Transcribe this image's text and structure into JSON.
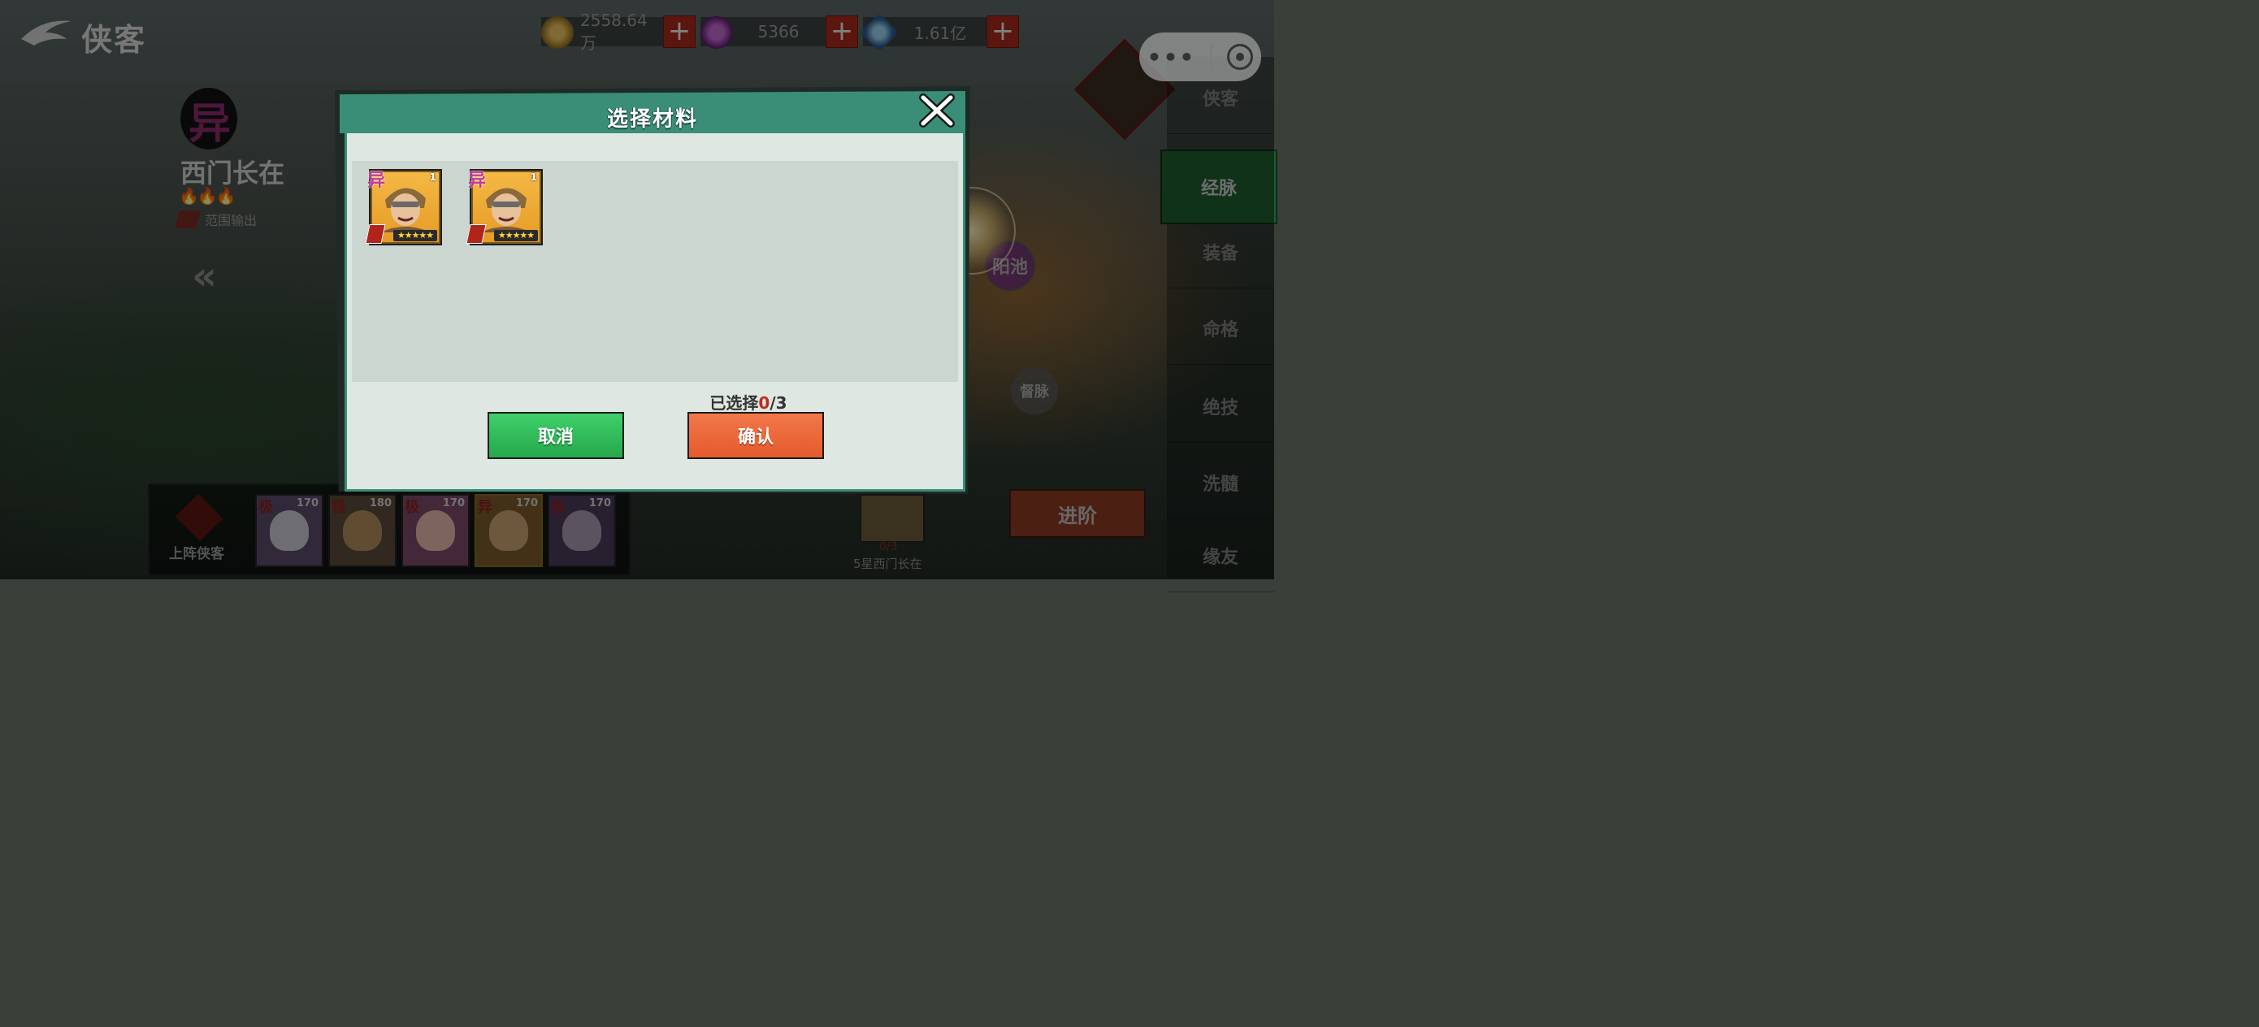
{
  "header": {
    "title": "侠客",
    "back_icon": "brush-back-icon"
  },
  "resources": [
    {
      "icon": "copper-coin-icon",
      "value": "2558.64万",
      "color": "#c69a3a"
    },
    {
      "icon": "purple-gem-icon",
      "value": "5366",
      "color": "#8a3aa0"
    },
    {
      "icon": "blue-crystal-icon",
      "value": "1.61亿",
      "color": "#4a8ac8"
    }
  ],
  "mini_program": {
    "more_icon": "more-dots-icon",
    "close_icon": "record-circle-icon"
  },
  "hero": {
    "faction_icon": "异",
    "name": "西门长在",
    "role": "范围输出",
    "background_snippet": "经脉"
  },
  "side_nav": [
    {
      "label": "侠客",
      "active": false
    },
    {
      "label": "经脉",
      "active": true
    },
    {
      "label": "装备",
      "active": false
    },
    {
      "label": "命格",
      "active": false
    },
    {
      "label": "绝技",
      "active": false
    },
    {
      "label": "洗髓",
      "active": false
    },
    {
      "label": "缘友",
      "active": false
    }
  ],
  "meridians": [
    {
      "label": "阳池"
    },
    {
      "label": "督脉"
    }
  ],
  "advance": {
    "label": "进阶",
    "material_count": "0/3",
    "material_label": "5星西门长在"
  },
  "lineup": {
    "label": "上阵侠客",
    "slots": [
      {
        "tag": "极",
        "level": "170",
        "color": "#6a4a8a"
      },
      {
        "tag": "极",
        "level": "180",
        "color": "#6a4a3a"
      },
      {
        "tag": "极",
        "level": "170",
        "color": "#8a4a7a"
      },
      {
        "tag": "异",
        "level": "170",
        "color": "#8a6a2a"
      },
      {
        "tag": "极",
        "level": "170",
        "color": "#5a3a6a"
      }
    ]
  },
  "modal": {
    "title": "选择材料",
    "close_icon": "close-x-icon",
    "cards": [
      {
        "level": "1",
        "badge": "异",
        "stars": 5
      },
      {
        "level": "1",
        "badge": "异",
        "stars": 5
      }
    ],
    "selected_label": "已选择",
    "selected_current": "0",
    "selected_total": "/3",
    "cancel_label": "取消",
    "confirm_label": "确认"
  }
}
